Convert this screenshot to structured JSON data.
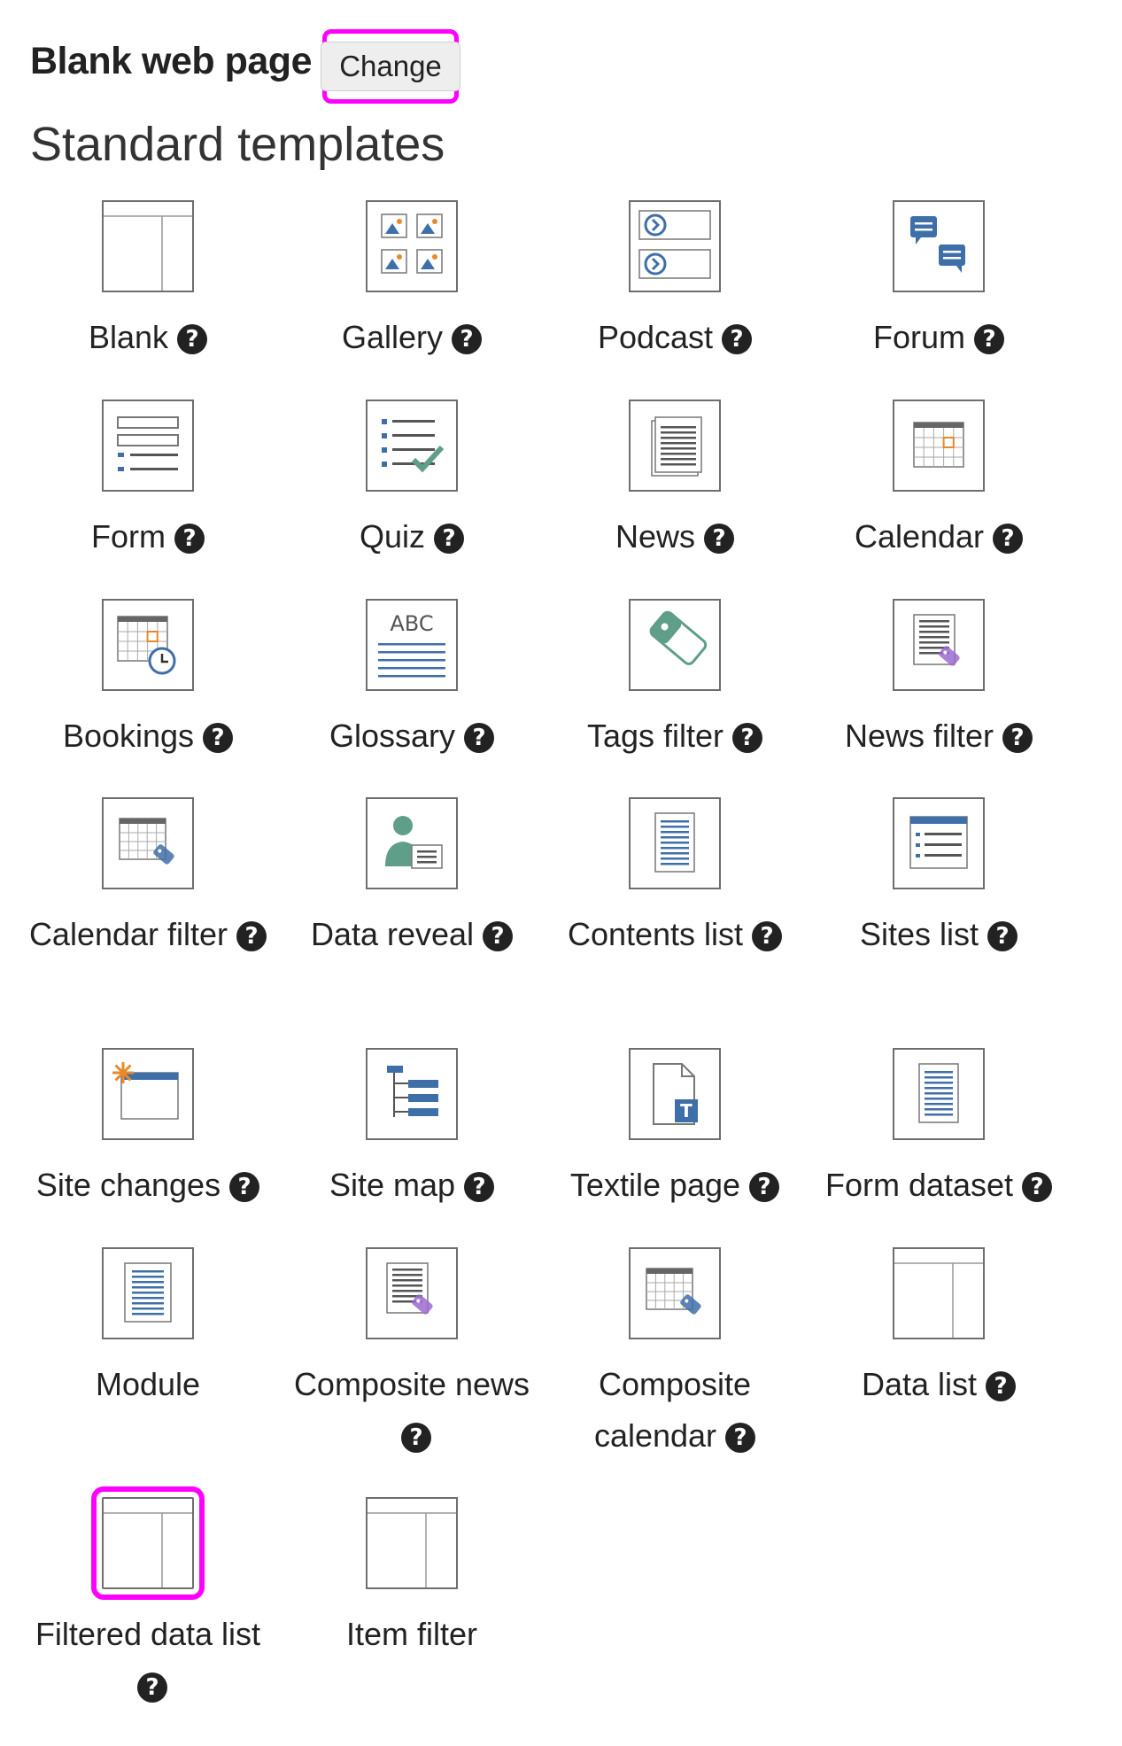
{
  "header": {
    "page_name": "Blank web page",
    "change_label": "Change"
  },
  "section_title": "Standard templates",
  "help_glyph": "?",
  "colors": {
    "highlight": "#ff00ff",
    "icon_blue": "#3f6fa8",
    "icon_orange": "#e8892b",
    "icon_green": "#5f9e89",
    "icon_purple": "#9c6ad1"
  },
  "templates": [
    {
      "label": "Blank",
      "icon": "blank-layout-icon",
      "help": true
    },
    {
      "label": "Gallery",
      "icon": "gallery-icon",
      "help": true
    },
    {
      "label": "Podcast",
      "icon": "podcast-icon",
      "help": true
    },
    {
      "label": "Forum",
      "icon": "forum-icon",
      "help": true
    },
    {
      "label": "Form",
      "icon": "form-icon",
      "help": true
    },
    {
      "label": "Quiz",
      "icon": "quiz-icon",
      "help": true
    },
    {
      "label": "News",
      "icon": "news-icon",
      "help": true
    },
    {
      "label": "Calendar",
      "icon": "calendar-icon",
      "help": true
    },
    {
      "label": "Bookings",
      "icon": "bookings-icon",
      "help": true
    },
    {
      "label": "Glossary",
      "icon": "glossary-icon",
      "help": true
    },
    {
      "label": "Tags filter",
      "icon": "tag-icon",
      "help": true
    },
    {
      "label": "News filter",
      "icon": "news-filter-icon",
      "help": true
    },
    {
      "label": "Calendar filter",
      "icon": "calendar-filter-icon",
      "help": true
    },
    {
      "label": "Data reveal",
      "icon": "data-reveal-icon",
      "help": true
    },
    {
      "label": "Contents list",
      "icon": "contents-list-icon",
      "help": true
    },
    {
      "label": "Sites list",
      "icon": "sites-list-icon",
      "help": true
    },
    {
      "label": "Site changes",
      "icon": "site-changes-icon",
      "help": true
    },
    {
      "label": "Site map",
      "icon": "site-map-icon",
      "help": true
    },
    {
      "label": "Textile page",
      "icon": "textile-page-icon",
      "help": true
    },
    {
      "label": "Form dataset",
      "icon": "form-dataset-icon",
      "help": true
    },
    {
      "label": "Module",
      "icon": "module-icon",
      "help": false
    },
    {
      "label": "Composite news",
      "icon": "composite-news-icon",
      "help": true
    },
    {
      "label": "Composite calendar",
      "icon": "composite-calendar-icon",
      "help": true
    },
    {
      "label": "Data list",
      "icon": "data-list-icon",
      "help": true
    },
    {
      "label": "Filtered data list",
      "icon": "filtered-data-list-icon",
      "help": true,
      "highlighted": true
    },
    {
      "label": "Item filter",
      "icon": "item-filter-icon",
      "help": false
    }
  ]
}
